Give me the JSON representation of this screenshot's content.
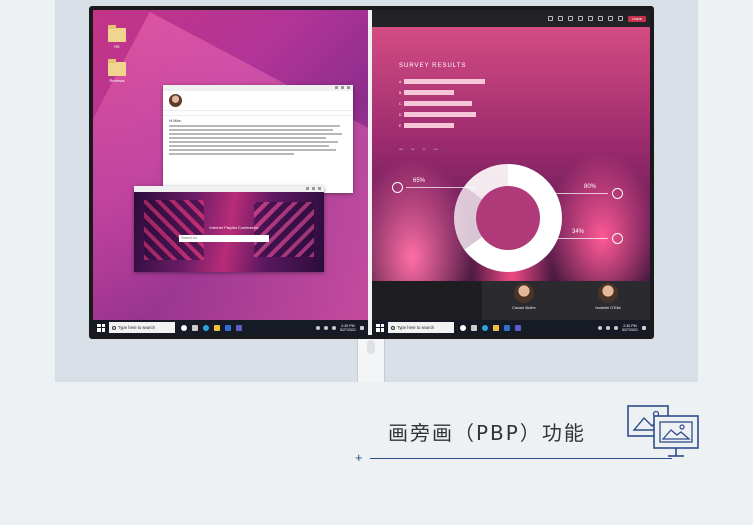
{
  "left_screen": {
    "desktop_icons": [
      {
        "label": "RE"
      },
      {
        "label": "Reviews"
      }
    ],
    "email": {
      "sender_lines": [
        "",
        "",
        ""
      ],
      "ribbon": [
        "",
        "",
        "",
        "",
        "",
        ""
      ],
      "salutation": "Hi Mike,"
    },
    "video": {
      "caption": "Internet Playlist Conference",
      "search_placeholder": "Search for"
    },
    "taskbar": {
      "search_text": "Type here to search",
      "time": "2:30 PM",
      "date": "5/27/2021"
    }
  },
  "right_screen": {
    "meeting": {
      "leave_label": "Leave"
    },
    "survey": {
      "title": "SURVEY RESULTS",
      "bars": [
        {
          "letter": "A",
          "value": 0.9
        },
        {
          "letter": "B",
          "value": 0.55
        },
        {
          "letter": "C",
          "value": 0.75
        },
        {
          "letter": "D",
          "value": 0.8
        },
        {
          "letter": "E",
          "value": 0.55
        }
      ],
      "stats": [
        {
          "value": "65%"
        },
        {
          "value": "80%"
        },
        {
          "value": "34%"
        }
      ]
    },
    "participants": [
      {
        "name": "Cassie Butler"
      },
      {
        "name": "Isabelle D'Elia"
      }
    ],
    "taskbar": {
      "search_text": "Type here to search",
      "time": "2:30 PM",
      "date": "5/27/2021"
    }
  },
  "caption": {
    "title": "画旁画（PBP）功能",
    "plus": "+"
  },
  "colors": {
    "accent": "#2e4d8a",
    "leave_red": "#c4314b"
  },
  "icons": [
    "folder-icon",
    "windows-start-icon",
    "search-icon",
    "pbp-dual-screen-icon"
  ]
}
